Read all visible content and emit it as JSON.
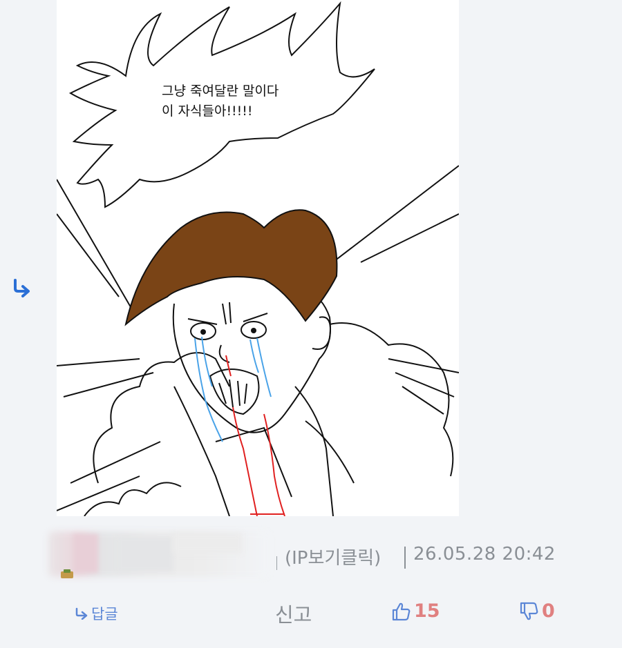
{
  "comment": {
    "speech_bubble": {
      "line1": "그냥 죽여달란 말이다",
      "line2": "이 자식들아!!!!!"
    },
    "meta": {
      "ip_label": "(IP보기클릭)",
      "datetime": "26.05.28 20:42"
    },
    "actions": {
      "reply_label": "답글",
      "report_label": "신고",
      "like_count": "15",
      "dislike_count": "0"
    }
  },
  "icons": {
    "reply_arrow": "reply-arrow-icon",
    "thumbs_up": "thumbs-up-icon",
    "thumbs_down": "thumbs-down-icon"
  },
  "colors": {
    "background": "#f2f4f7",
    "link_blue": "#5b86d6",
    "meta_gray": "#8a8f95",
    "count_red": "#e08080",
    "hair_brown": "#7a4416"
  }
}
